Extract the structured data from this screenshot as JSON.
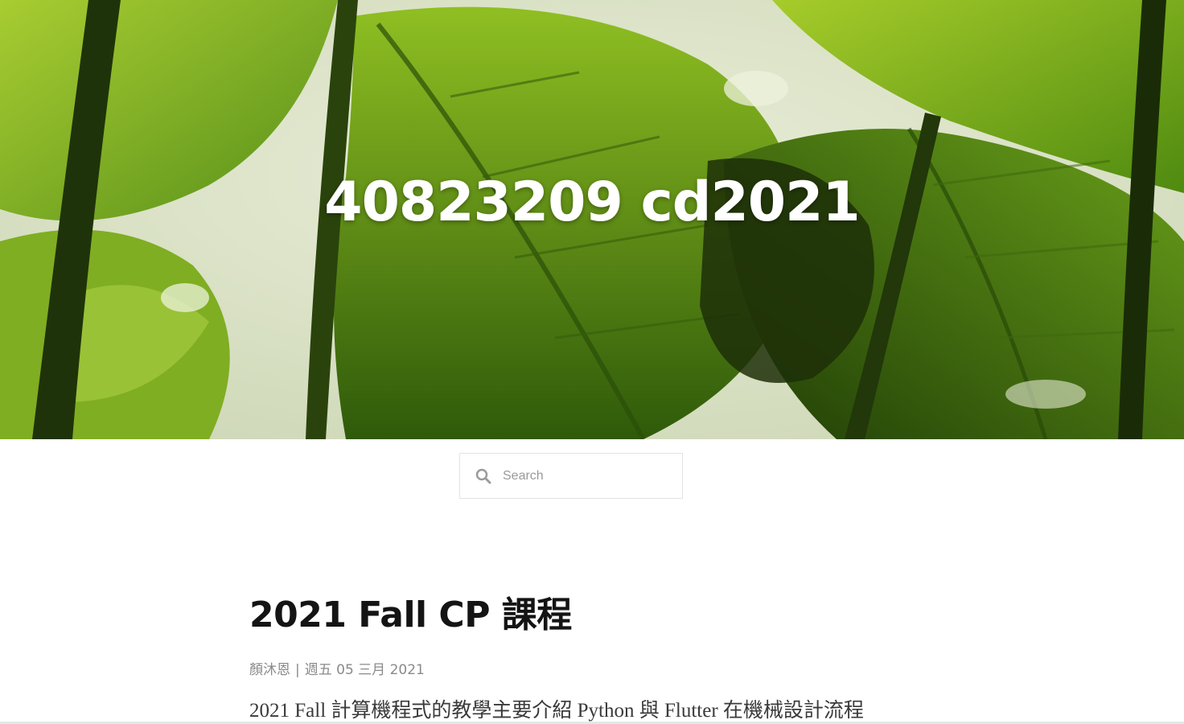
{
  "site": {
    "title": "40823209 cd2021"
  },
  "search": {
    "placeholder": "Search",
    "icon": "search-icon"
  },
  "post": {
    "title": "2021 Fall CP 課程",
    "author": "顏沐恩",
    "separator": "|",
    "date": "週五 05 三月 2021",
    "excerpt": "2021 Fall 計算機程式的教學主要介紹 Python 與 Flutter 在機械設計流程"
  },
  "colors": {
    "hero_green": "#4b7a17",
    "title_text": "#ffffff",
    "meta_text": "#8a8a8a",
    "border": "#e3e3e3"
  }
}
